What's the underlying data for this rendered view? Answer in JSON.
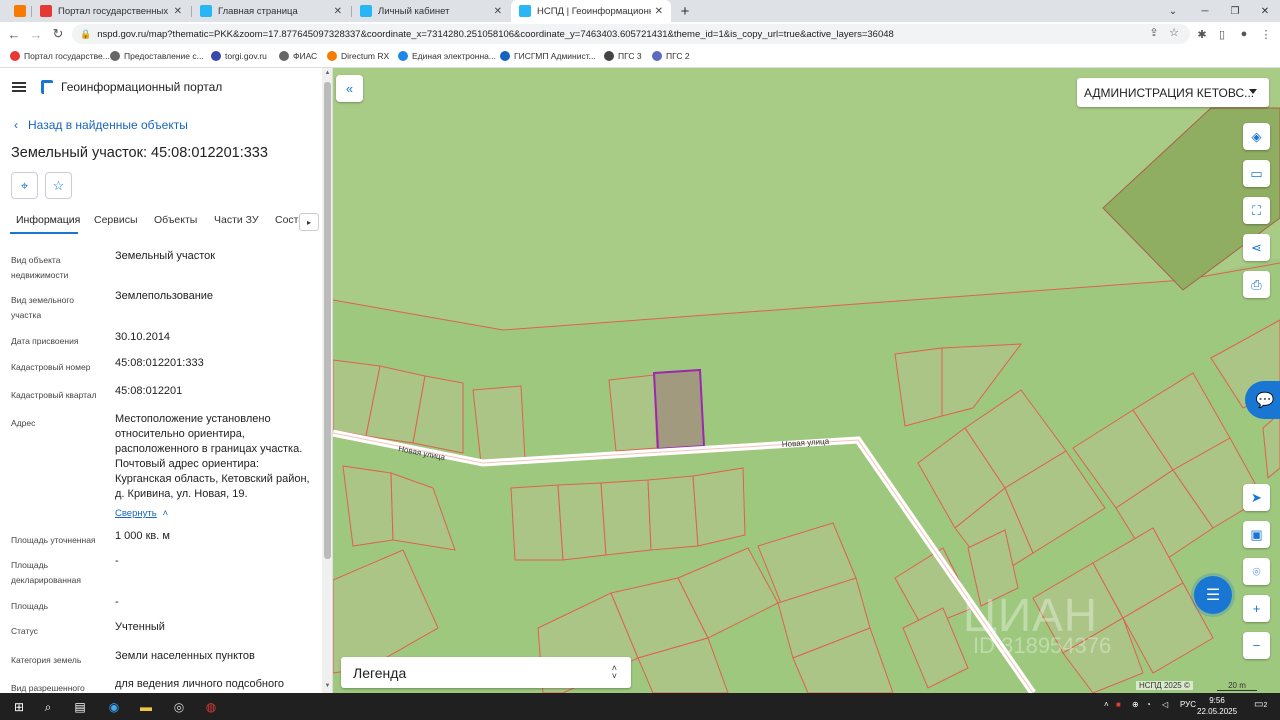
{
  "browser": {
    "tabs": [
      {
        "title": "Портал государственных услуг",
        "color": "#e53935"
      },
      {
        "title": "Главная страница",
        "color": "#29b6f6"
      },
      {
        "title": "Личный кабинет",
        "color": "#29b6f6"
      },
      {
        "title": "НСПД | Геоинформационный п",
        "color": "#29b6f6"
      }
    ],
    "url": "nspd.gov.ru/map?thematic=PKK&zoom=17.877645097328337&coordinate_x=7314280.251058106&coordinate_y=7463403.605721431&theme_id=1&is_copy_url=true&active_layers=36048",
    "bookmarks": [
      "Портал государстве...",
      "Предоставление с...",
      "torgi.gov.ru",
      "ФИАС",
      "Directum RX",
      "Единая электронна...",
      "ГИСГМП Админист...",
      "ПГС 3",
      "ПГС 2"
    ]
  },
  "panel": {
    "portal_title": "Геоинформационный портал",
    "back_label": "Назад в найденные объекты",
    "object_title": "Земельный участок: 45:08:012201:333",
    "tabs": [
      "Информация",
      "Сервисы",
      "Объекты",
      "Части ЗУ",
      "Соста"
    ],
    "fields": [
      {
        "label": "Вид объекта недвижимости",
        "value": "Земельный участок"
      },
      {
        "label": "Вид земельного участка",
        "value": "Землепользование"
      },
      {
        "label": "Дата присвоения",
        "value": "30.10.2014"
      },
      {
        "label": "Кадастровый номер",
        "value": "45:08:012201:333"
      },
      {
        "label": "Кадастровый квартал",
        "value": "45:08:012201"
      },
      {
        "label": "Адрес",
        "value": "Местоположение установлено относительно ориентира, расположенного в границах участка. Почтовый адрес ориентира: Курганская область, Кетовский район, д. Кривина, ул. Новая, 19."
      },
      {
        "label": "Площадь уточненная",
        "value": "1 000 кв. м"
      },
      {
        "label": "Площадь декларированная",
        "value": "-"
      },
      {
        "label": "Площадь",
        "value": "-"
      },
      {
        "label": "Статус",
        "value": "Учтенный"
      },
      {
        "label": "Категория земель",
        "value": "Земли населенных пунктов"
      },
      {
        "label": "Вид разрешенного",
        "value": "для ведения личного подсобного"
      }
    ],
    "collapse_label": "Свернуть"
  },
  "map": {
    "admin_dropdown": "АДМИНИСТРАЦИЯ КЕТОВС...",
    "street_label_1": "Новая улица",
    "street_label_2": "Новая улица",
    "legend_label": "Легенда",
    "copyright": "НСПД 2025 ©",
    "scale": "20 m",
    "watermark": "ЦИАН",
    "watermark_id": "ID 318954376",
    "colors": {
      "background": "#9fc87f",
      "parcel_border": "#e06050",
      "selected": "#9c27b0",
      "accent": "#1976d2"
    }
  },
  "taskbar": {
    "lang": "РУС",
    "time": "9:56",
    "date": "22.05.2025",
    "notifications": "2"
  }
}
